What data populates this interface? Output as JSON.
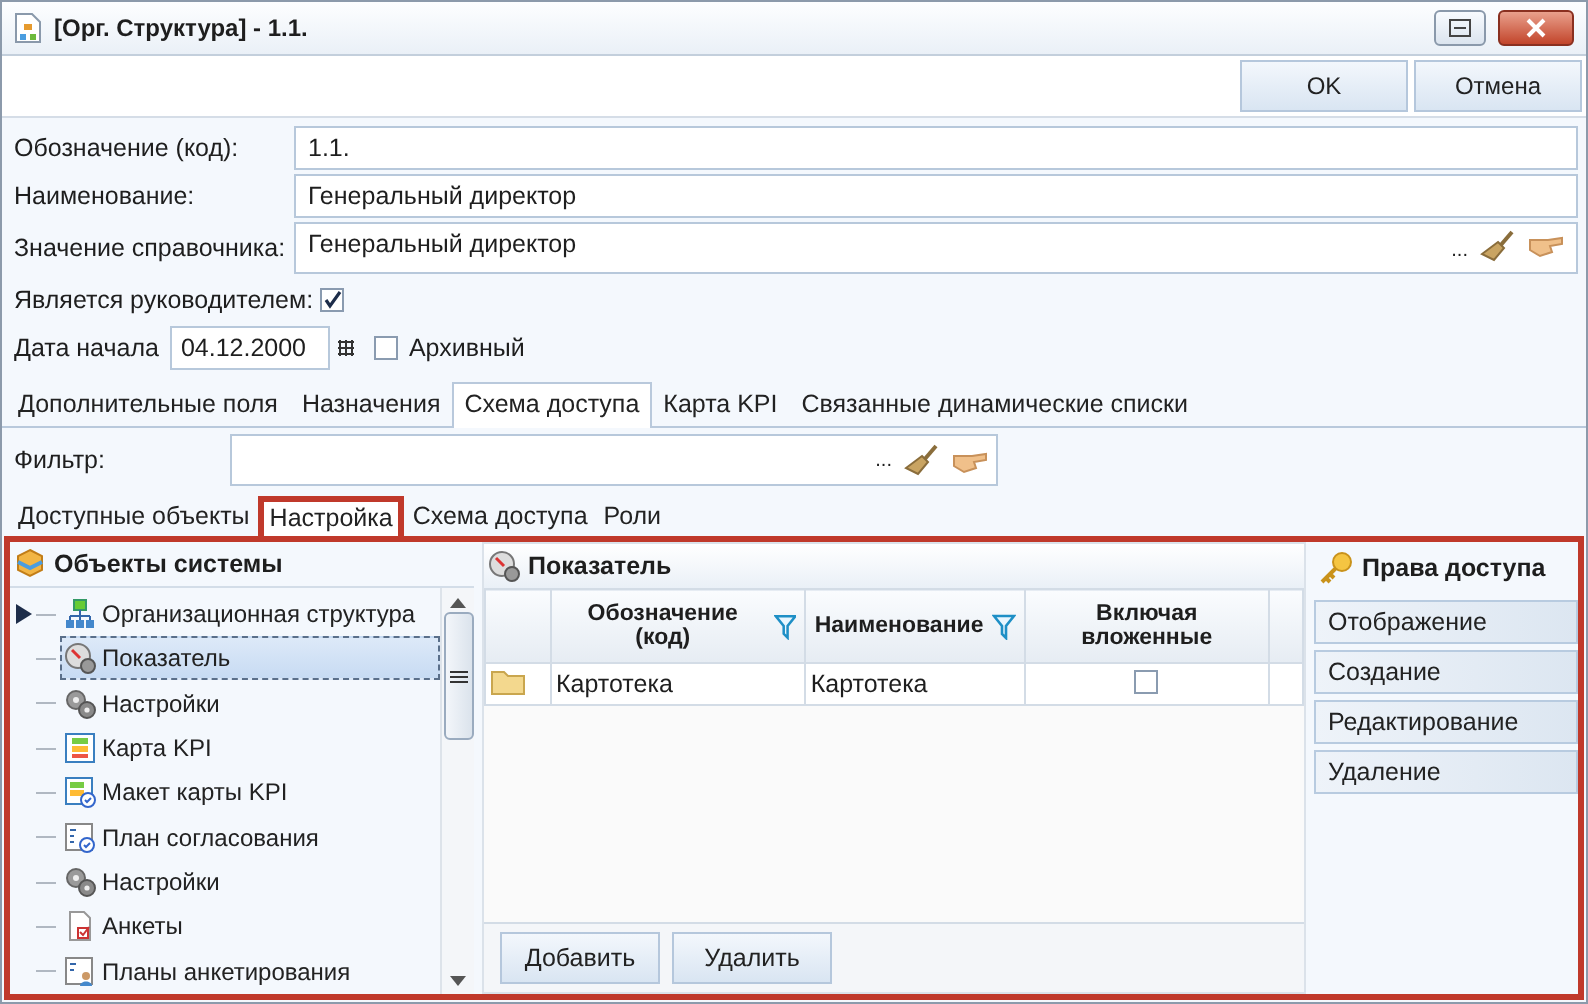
{
  "window": {
    "title": "[Орг. Структура] - 1.1."
  },
  "toolbar": {
    "buttons": [
      "OK",
      "Отмена"
    ]
  },
  "fields": [
    {
      "label": "Обозначение (код):",
      "value": "1.1.",
      "kind": "text"
    },
    {
      "label": "Наименование:",
      "value": "Генеральный директор",
      "kind": "text"
    },
    {
      "label": "Значение справочника:",
      "value": "Генеральный директор",
      "kind": "lookup",
      "dots": "..."
    }
  ],
  "is_manager": {
    "label": "Является руководителем:",
    "checked": true
  },
  "start_date": {
    "label": "Дата начала",
    "value": "04.12.2000"
  },
  "archived": {
    "label": "Архивный",
    "checked": false
  },
  "tabs": [
    {
      "label": "Дополнительные поля",
      "selected": false
    },
    {
      "label": "Назначения",
      "selected": false
    },
    {
      "label": "Схема доступа",
      "selected": true
    },
    {
      "label": "Карта KPI",
      "selected": false
    },
    {
      "label": "Связанные динамические списки",
      "selected": false
    }
  ],
  "filter": {
    "label": "Фильтр:",
    "dots": "..."
  },
  "subtabs": [
    {
      "label": "Доступные объекты",
      "selected": false
    },
    {
      "label": "Настройка",
      "selected": true
    },
    {
      "label": "Схема доступа",
      "selected": false
    },
    {
      "label": "Роли",
      "selected": false
    }
  ],
  "objects": {
    "title": "Объекты системы",
    "items": [
      {
        "label": "Организационная структура",
        "kind": "org",
        "expandable": true,
        "selected": false
      },
      {
        "label": "Показатель",
        "kind": "indicator",
        "expandable": false,
        "selected": true
      },
      {
        "label": "Настройки",
        "kind": "gears",
        "expandable": false,
        "selected": false
      },
      {
        "label": "Карта KPI",
        "kind": "kpi",
        "expandable": false,
        "selected": false
      },
      {
        "label": "Макет карты KPI",
        "kind": "kpi-layout",
        "expandable": false,
        "selected": false
      },
      {
        "label": "План согласования",
        "kind": "plan",
        "expandable": false,
        "selected": false
      },
      {
        "label": "Настройки",
        "kind": "gears",
        "expandable": false,
        "selected": false
      },
      {
        "label": "Анкеты",
        "kind": "survey",
        "expandable": false,
        "selected": false
      },
      {
        "label": "Планы анкетирования",
        "kind": "survey-plan",
        "expandable": false,
        "selected": false
      }
    ]
  },
  "indicator": {
    "title": "Показатель",
    "columns": [
      {
        "label": "Обозначение (код)",
        "filter": true
      },
      {
        "label": "Наименование",
        "filter": true
      },
      {
        "label": "Включая вложенные",
        "filter": false
      }
    ],
    "rows": [
      {
        "code": "Картотека",
        "name": "Картотека",
        "include_nested": false
      }
    ],
    "buttons": [
      "Добавить",
      "Удалить"
    ]
  },
  "rights": {
    "title": "Права доступа",
    "items": [
      "Отображение",
      "Создание",
      "Редактирование",
      "Удаление"
    ]
  }
}
